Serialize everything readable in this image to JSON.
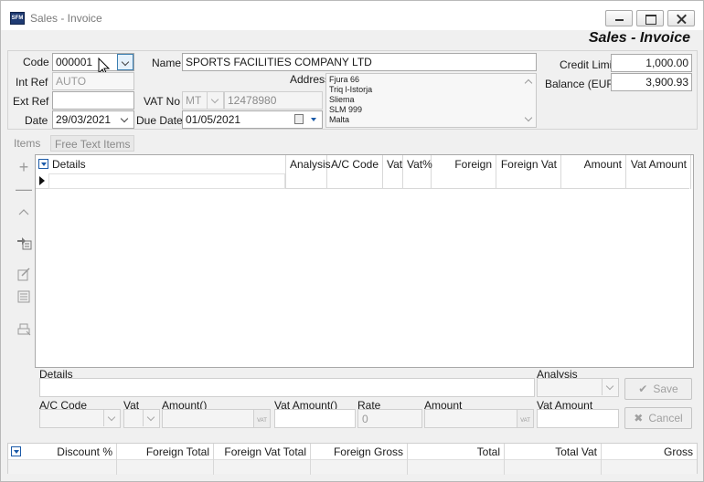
{
  "window": {
    "title": "Sales - Invoice",
    "icon_label": "SFM",
    "heading": "Sales - Invoice"
  },
  "header": {
    "code_label": "Code",
    "code_value": "000001",
    "name_label": "Name",
    "name_value": "SPORTS FACILITIES COMPANY LTD",
    "int_ref_label": "Int Ref",
    "int_ref_value": "AUTO",
    "ext_ref_label": "Ext Ref",
    "ext_ref_value": "",
    "date_label": "Date",
    "date_value": "29/03/2021",
    "address_label": "Address",
    "address_lines": [
      "Fjura 66",
      "Triq l-Istorja",
      "Sliema",
      "SLM 999",
      "Malta"
    ],
    "vat_no_label": "VAT No",
    "vat_country": "MT",
    "vat_number": "12478980",
    "due_date_label": "Due Date",
    "due_date_value": "01/05/2021",
    "credit_limit_label": "Credit Limit",
    "credit_limit_value": "1,000.00",
    "balance_label": "Balance (EUR)",
    "balance_value": "3,900.93"
  },
  "tabs": [
    {
      "label": "Items",
      "active": true
    },
    {
      "label": "Free Text Items",
      "active": false
    }
  ],
  "toolbar": {
    "icons": [
      "add-icon",
      "remove-icon",
      "move-up-icon",
      "copy-row-icon",
      "edit-row-icon",
      "notes-icon",
      "print-row-icon"
    ]
  },
  "grid": {
    "columns": [
      "Details",
      "Analysis",
      "A/C Code",
      "Vat",
      "Vat%",
      "Foreign",
      "Foreign Vat",
      "Amount",
      "Vat Amount"
    ]
  },
  "editor": {
    "details_label": "Details",
    "analysis_label": "Analysis",
    "ac_code_label": "A/C Code",
    "vat_label": "Vat",
    "amount_label": "Amount()",
    "vat_amount_label": "Vat Amount()",
    "rate_label": "Rate",
    "rate_value": "0",
    "amount2_label": "Amount",
    "vat_amount2_label": "Vat Amount",
    "vat_btn_label": "VAT",
    "save_label": "Save",
    "cancel_label": "Cancel"
  },
  "totals": {
    "columns": [
      "Discount %",
      "Foreign Total",
      "Foreign Vat Total",
      "Foreign Gross",
      "Total",
      "Total Vat",
      "Gross"
    ]
  }
}
